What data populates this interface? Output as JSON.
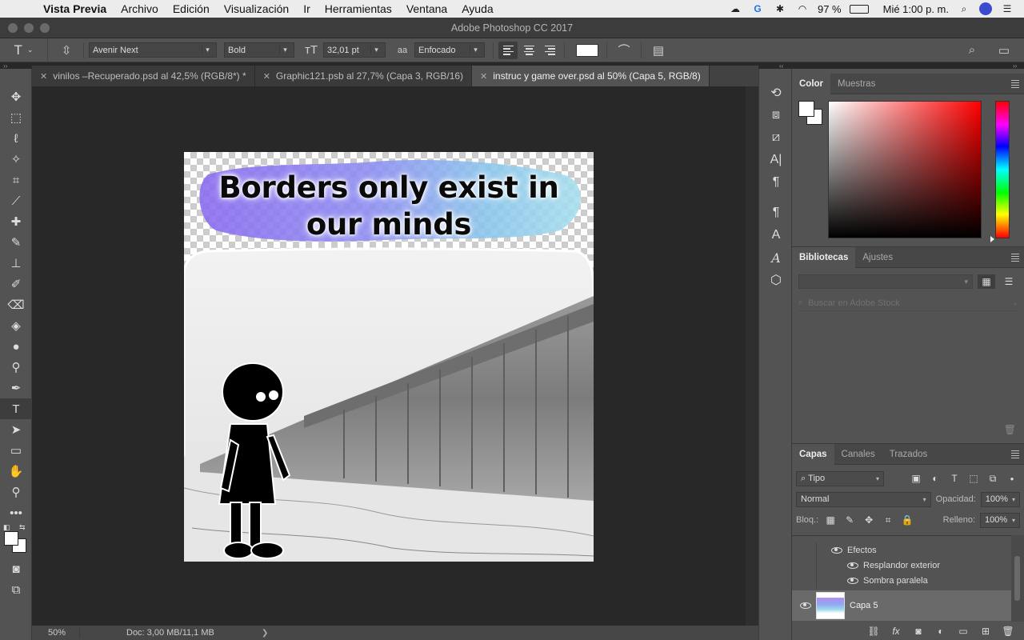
{
  "menubar": {
    "app": "Vista Previa",
    "items": [
      "Archivo",
      "Edición",
      "Visualización",
      "Ir",
      "Herramientas",
      "Ventana",
      "Ayuda"
    ],
    "battery": "97 %",
    "clock": "Mié 1:00 p. m."
  },
  "window": {
    "title": "Adobe Photoshop CC 2017"
  },
  "options": {
    "font_family": "Avenir Next",
    "font_style": "Bold",
    "font_size": "32,01 pt",
    "antialias_icon": "aa",
    "antialias": "Enfocado",
    "text_color": "#ffffff"
  },
  "tabs": [
    {
      "label": "vinilos –Recuperado.psd al 42,5% (RGB/8*) *",
      "active": false
    },
    {
      "label": "Graphic121.psb al 27,7% (Capa 3, RGB/16)",
      "active": false
    },
    {
      "label": "instruc y game over.psd al 50% (Capa 5, RGB/8)",
      "active": true
    }
  ],
  "canvas": {
    "headline_line1": "Borders only exist in",
    "headline_line2": "our minds"
  },
  "status": {
    "zoom": "50%",
    "doc": "Doc: 3,00 MB/11,1 MB"
  },
  "color_panel": {
    "tabs": [
      "Color",
      "Muestras"
    ]
  },
  "libraries_panel": {
    "tabs": [
      "Bibliotecas",
      "Ajustes"
    ],
    "search_placeholder": "Buscar en Adobe Stock"
  },
  "layers_panel": {
    "tabs": [
      "Capas",
      "Canales",
      "Trazados"
    ],
    "filter": "Tipo",
    "blend_mode": "Normal",
    "opacity_label": "Opacidad:",
    "opacity": "100%",
    "lock_label": "Bloq.:",
    "fill_label": "Relleno:",
    "fill": "100%",
    "effects_label": "Efectos",
    "effects": [
      "Resplandor exterior",
      "Sombra paralela"
    ],
    "layer_name": "Capa 5"
  }
}
